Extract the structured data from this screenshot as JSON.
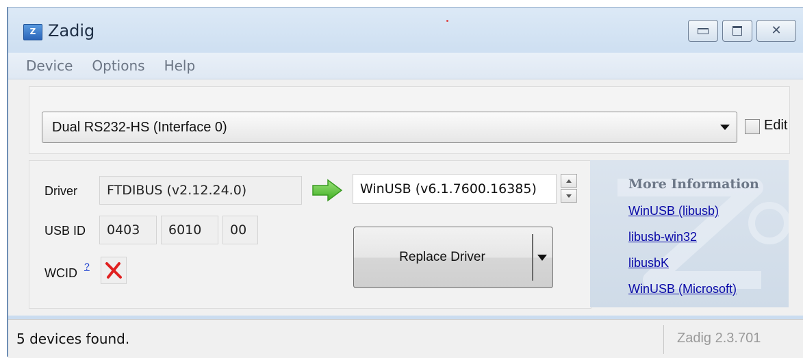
{
  "window": {
    "title": "Zadig",
    "app_icon_letter": "Z",
    "buttons": [
      "minimize",
      "maximize",
      "close"
    ]
  },
  "menu": {
    "items": [
      "Device",
      "Options",
      "Help"
    ]
  },
  "device_selector": {
    "selected": "Dual RS232-HS (Interface 0)",
    "edit_label": "Edit",
    "edit_checked": false
  },
  "driver_panel": {
    "driver_label": "Driver",
    "current_driver": "FTDIBUS (v2.12.24.0)",
    "usb_id_label": "USB ID",
    "usb_id": [
      "0403",
      "6010",
      "00"
    ],
    "wcid_label": "WCID",
    "wcid_help": "?",
    "wcid_status_icon": "red-x-icon",
    "target_driver": "WinUSB (v6.1.7600.16385)",
    "replace_button": "Replace Driver"
  },
  "info_panel": {
    "title": "More Information",
    "links": [
      "WinUSB (libusb)",
      "libusb-win32",
      "libusbK",
      "WinUSB (Microsoft)"
    ]
  },
  "status": {
    "left": "5 devices found.",
    "right": "Zadig 2.3.701"
  },
  "colors": {
    "title_gradient_top": "#dce9f6",
    "client_bg": "#f0f0f0",
    "link": "#0a0aa8",
    "arrow_green": "#5cc63a",
    "x_red": "#e02020"
  }
}
